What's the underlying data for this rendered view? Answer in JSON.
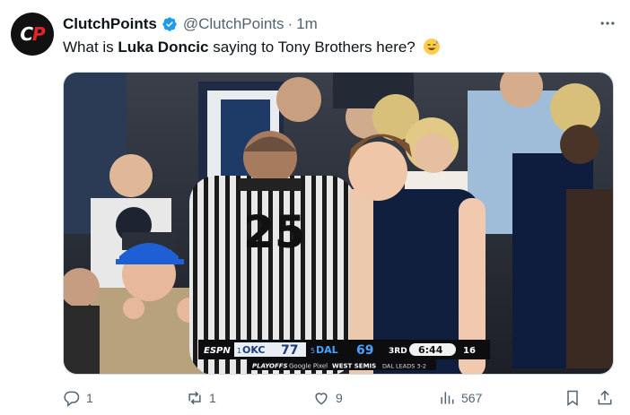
{
  "author": {
    "name": "ClutchPoints",
    "handle": "@ClutchPoints",
    "separator": "·",
    "time": "1m",
    "avatar_text": "CP",
    "verified": true
  },
  "tweet": {
    "text_before": "What is ",
    "bold_name": "Luka Doncic",
    "text_after": " saying to Tony Brothers here?",
    "emoji": "sweat-smile-emoji"
  },
  "media": {
    "referee_number": "25",
    "scorebug": {
      "network": "ESPN",
      "team1_seed": "1",
      "team1": "OKC",
      "team1_score": "77",
      "team2_seed": "5",
      "team2": "DAL",
      "team2_score": "69",
      "quarter": "3RD",
      "clock": "6:44",
      "shot_clock": "16",
      "playoffs": "PLAYOFFS",
      "sponsor": "Google Pixel",
      "series": "WEST SEMIS",
      "series_status": "DAL LEADS 3-2"
    }
  },
  "stats": {
    "replies": "1",
    "reposts": "1",
    "likes": "9",
    "views": "567"
  },
  "colors": {
    "text": "#0f1419",
    "secondary": "#536471",
    "verified_blue": "#1d9bf0",
    "brand_red": "#e4232b"
  }
}
